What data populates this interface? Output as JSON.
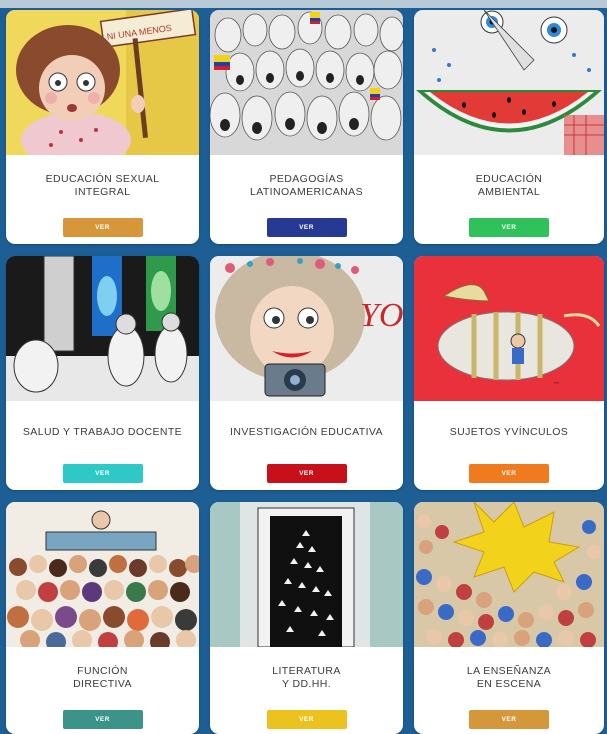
{
  "cards": [
    {
      "title": "EDUCACIÓN SEXUAL\nINTEGRAL",
      "button": "VER",
      "color": "#d5973a",
      "sign_text": "NI UNA MENOS"
    },
    {
      "title": "PEDAGOGÍAS\nLATINOAMERICANAS",
      "button": "VER",
      "color": "#273a93"
    },
    {
      "title": "EDUCACIÓN\nAMBIENTAL",
      "button": "VER",
      "color": "#2fc25a"
    },
    {
      "title": "SALUD Y TRABAJO DOCENTE",
      "button": "VER",
      "color": "#2ec9c6"
    },
    {
      "title": "INVESTIGACIÓN EDUCATIVA",
      "button": "VER",
      "color": "#c8101b",
      "art_text": "YO"
    },
    {
      "title": "SUJETOS YVÍNCULOS",
      "button": "VER",
      "color": "#f07a1e"
    },
    {
      "title": "FUNCIÓN\nDIRECTIVA",
      "button": "VER",
      "color": "#3b9389"
    },
    {
      "title": "LITERATURA\nY DD.HH.",
      "button": "VER",
      "color": "#ecc21f"
    },
    {
      "title": "LA ENSEÑANZA\nEN ESCENA",
      "button": "VER",
      "color": "#d4983a"
    }
  ]
}
